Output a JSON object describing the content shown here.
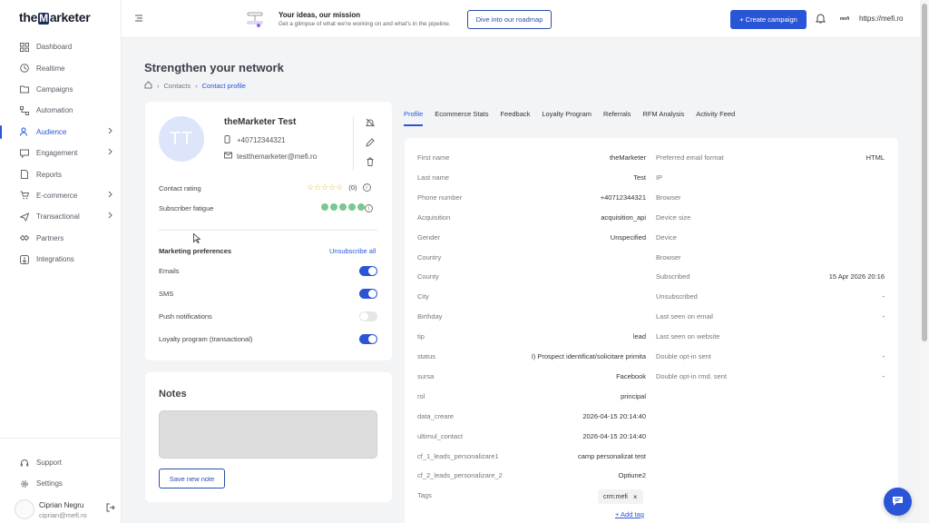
{
  "app": {
    "logo_pre": "the",
    "logo_m": "M",
    "logo_post": "arketer"
  },
  "sidebar": {
    "items": [
      {
        "label": "Dashboard"
      },
      {
        "label": "Realtime"
      },
      {
        "label": "Campaigns"
      },
      {
        "label": "Automation"
      },
      {
        "label": "Audience"
      },
      {
        "label": "Engagement"
      },
      {
        "label": "Reports"
      },
      {
        "label": "E-commerce"
      },
      {
        "label": "Transactional"
      },
      {
        "label": "Partners"
      },
      {
        "label": "Integrations"
      }
    ],
    "bottom": [
      {
        "label": "Support"
      },
      {
        "label": "Settings"
      }
    ],
    "user": {
      "name": "Ciprian Negru",
      "email": "ciprian@mefi.ro"
    }
  },
  "topbar": {
    "mission_title": "Your ideas, our mission",
    "mission_sub": "Get a glimpse of what we're working on and what's in the pipeline.",
    "roadmap_label": "Dive into our roadmap",
    "create_label": "+ Create campaign",
    "account_logo": "mefi",
    "account_url": "https://mefi.ro"
  },
  "page": {
    "title": "Strengthen your network",
    "breadcrumb": [
      "Contacts",
      "Contact profile"
    ]
  },
  "contact": {
    "initials": "TT",
    "name": "theMarketer Test",
    "phone": "+40712344321",
    "email": "testthemarketer@mefi.ro",
    "rating_label": "Contact rating",
    "rating_stars": "☆☆☆☆☆",
    "rating_count": "(0)",
    "fatigue_label": "Subscriber fatigue",
    "fatigue_level": 5
  },
  "prefs": {
    "title": "Marketing preferences",
    "unsubscribe_label": "Unsubscribe all",
    "items": [
      {
        "label": "Emails",
        "on": true
      },
      {
        "label": "SMS",
        "on": true
      },
      {
        "label": "Push notifications",
        "on": false
      },
      {
        "label": "Loyalty program (transactional)",
        "on": true
      }
    ]
  },
  "notes": {
    "title": "Notes",
    "new_label": "Save new note"
  },
  "tabs": [
    "Profile",
    "Ecommerce Stats",
    "Feedback",
    "Loyalty Program",
    "Referrals",
    "RFM Analysis",
    "Activity Feed"
  ],
  "profile": {
    "left": [
      {
        "label": "First name",
        "value": "theMarketer"
      },
      {
        "label": "Last name",
        "value": "Test"
      },
      {
        "label": "Phone number",
        "value": "+40712344321"
      },
      {
        "label": "Acquisition",
        "value": "acquisition_api"
      },
      {
        "label": "Gender",
        "value": "Unspecified"
      },
      {
        "label": "Country",
        "value": ""
      },
      {
        "label": "County",
        "value": ""
      },
      {
        "label": "City",
        "value": ""
      },
      {
        "label": "Birthday",
        "value": ""
      },
      {
        "label": "tip",
        "value": "lead"
      },
      {
        "label": "status",
        "value": "I) Prospect identificat/solicitare primita"
      },
      {
        "label": "sursa",
        "value": "Facebook"
      },
      {
        "label": "rol",
        "value": "principal"
      },
      {
        "label": "data_creare",
        "value": "2026-04-15 20:14:40"
      },
      {
        "label": "ultimul_contact",
        "value": "2026-04-15 20:14:40"
      },
      {
        "label": "cf_1_leads_personalizare1",
        "value": "camp personalizat test"
      },
      {
        "label": "cf_2_leads_personalizare_2",
        "value": "Optiune2"
      },
      {
        "label": "Tags",
        "value": ""
      }
    ],
    "right": [
      {
        "label": "Preferred email format",
        "value": "HTML"
      },
      {
        "label": "IP",
        "value": ""
      },
      {
        "label": "Browser",
        "value": ""
      },
      {
        "label": "Device size",
        "value": ""
      },
      {
        "label": "Device",
        "value": ""
      },
      {
        "label": "Browser",
        "value": ""
      },
      {
        "label": "Subscribed",
        "value": "15 Apr 2026 20:16"
      },
      {
        "label": "Unsubscribed",
        "value": "-"
      },
      {
        "label": "Last seen on email",
        "value": "-"
      },
      {
        "label": "Last seen on website",
        "value": ""
      },
      {
        "label": "Double opt-in sent",
        "value": "-"
      },
      {
        "label": "Double opt-in rmd. sent",
        "value": "-"
      }
    ],
    "tag": "crm:mefi",
    "add_tag": "+ Add tag"
  },
  "colors": {
    "accent": "#2a55d6",
    "rating": "#e2b33c",
    "fatigue": "#7cc78f"
  }
}
